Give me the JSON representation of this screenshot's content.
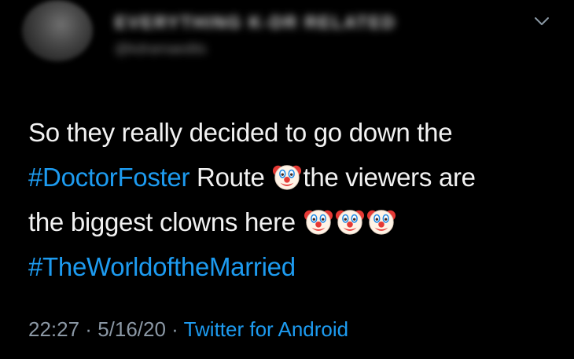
{
  "user": {
    "display_name": "EVERYTHING K-DR RELATED",
    "handle": "@kdramaedits",
    "avatar": "blurred-profile-photo"
  },
  "menu_icon": "chevron-down-icon",
  "tweet": {
    "line1": "So they really decided to go down the",
    "line2_hashtag": "#DoctorFoster",
    "line2_text": " Route ",
    "line2_rest": "the viewers are",
    "line3_text": "the biggest clowns here ",
    "line4_hashtag": "#TheWorldoftheMarried",
    "emoji": "clown-face-icon"
  },
  "meta": {
    "time": "22:27",
    "separator": " · ",
    "date": "5/16/20",
    "source": "Twitter for Android"
  },
  "colors": {
    "background": "#000000",
    "text": "#f2f2f2",
    "link": "#1d9bf0",
    "muted": "#8b98a5"
  }
}
